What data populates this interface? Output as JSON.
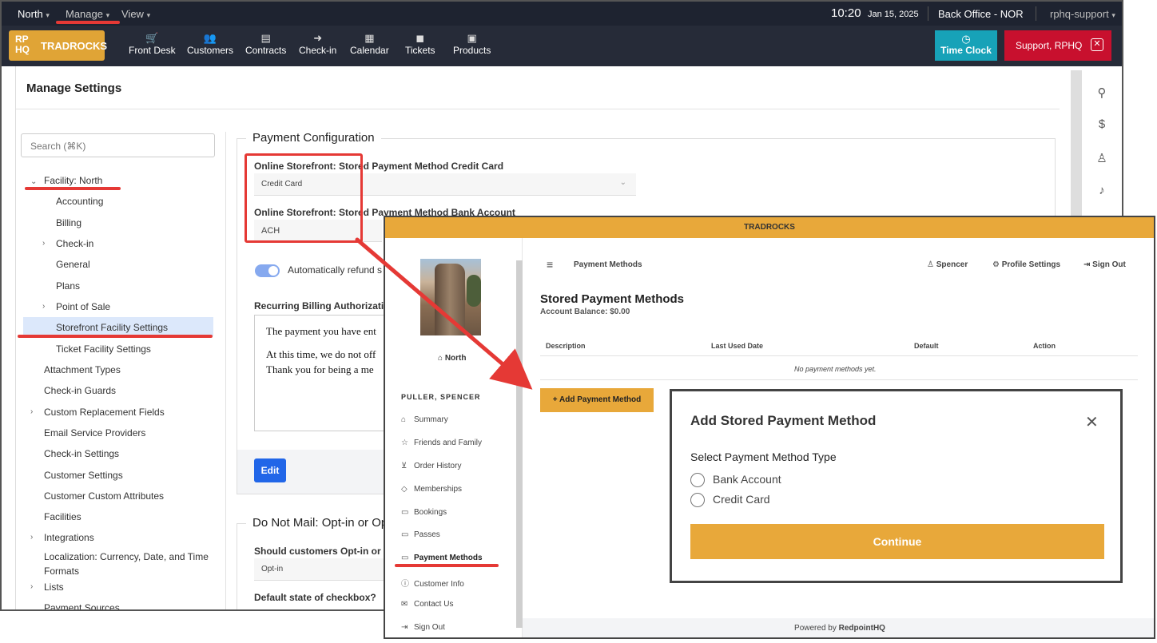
{
  "topbar": {
    "location": "North",
    "menu_manage": "Manage",
    "menu_view": "View",
    "time": "10:20",
    "date": "Jan 15, 2025",
    "office": "Back Office - NOR",
    "user": "rphq-support"
  },
  "navbar": {
    "logo_mark": "RP HQ",
    "logo_name": "TRADROCKS",
    "items": [
      {
        "label": "Front Desk",
        "icon": "cart-icon"
      },
      {
        "label": "Customers",
        "icon": "users-icon"
      },
      {
        "label": "Contracts",
        "icon": "contracts-icon"
      },
      {
        "label": "Check-in",
        "icon": "arrow-circle-icon"
      },
      {
        "label": "Calendar",
        "icon": "calendar-icon"
      },
      {
        "label": "Tickets",
        "icon": "chat-icon"
      },
      {
        "label": "Products",
        "icon": "boxes-icon"
      }
    ],
    "time_clock": "Time Clock",
    "support": "Support, RPHQ"
  },
  "settings": {
    "title": "Manage Settings",
    "search_placeholder": "Search (⌘K)",
    "tree": {
      "facility": "Facility: North",
      "accounting": "Accounting",
      "billing": "Billing",
      "checkin": "Check-in",
      "general": "General",
      "plans": "Plans",
      "pos": "Point of Sale",
      "storefront": "Storefront Facility Settings",
      "ticket": "Ticket Facility Settings",
      "attachment": "Attachment Types",
      "guards": "Check-in Guards",
      "custom_fields": "Custom Replacement Fields",
      "email": "Email Service Providers",
      "checkin_settings": "Check-in Settings",
      "customer_settings": "Customer Settings",
      "custom_attrs": "Customer Custom Attributes",
      "facilities": "Facilities",
      "integrations": "Integrations",
      "localization": "Localization: Currency, Date, and Time Formats",
      "lists": "Lists",
      "payment_sources": "Payment Sources"
    },
    "payment_config": {
      "legend": "Payment Configuration",
      "cc_label": "Online Storefront: Stored Payment Method Credit Card",
      "cc_value": "Credit Card",
      "ach_label": "Online Storefront: Stored Payment Method Bank Account",
      "ach_value": "ACH",
      "toggle_label": "Automatically refund s",
      "recurring_label": "Recurring Billing Authorization",
      "recurring_line1": "The payment you have ent",
      "recurring_line2": "At this time, we do not off",
      "recurring_line3": "Thank you for being a me",
      "edit": "Edit"
    },
    "do_not_mail": {
      "legend": "Do Not Mail: Opt-in or Op",
      "question": "Should customers Opt-in or Op",
      "value": "Opt-in",
      "default_label": "Default state of checkbox?"
    }
  },
  "storefront": {
    "header": "TRADROCKS",
    "location": "North",
    "customer_name": "PULLER, SPENCER",
    "nav": [
      {
        "label": "Summary",
        "icon": "home-icon"
      },
      {
        "label": "Friends and Family",
        "icon": "star-icon"
      },
      {
        "label": "Order History",
        "icon": "cart-icon"
      },
      {
        "label": "Memberships",
        "icon": "tag-icon"
      },
      {
        "label": "Bookings",
        "icon": "calendar-icon"
      },
      {
        "label": "Passes",
        "icon": "ticket-icon"
      },
      {
        "label": "Payment Methods",
        "icon": "card-icon"
      },
      {
        "label": "Customer Info",
        "icon": "info-icon"
      },
      {
        "label": "Contact Us",
        "icon": "mail-icon"
      },
      {
        "label": "Sign Out",
        "icon": "signout-icon"
      }
    ],
    "page_label": "Payment Methods",
    "user": "Spencer",
    "profile": "Profile Settings",
    "signout": "Sign Out",
    "heading": "Stored Payment Methods",
    "balance": "Account Balance: $0.00",
    "columns": [
      "Description",
      "Last Used Date",
      "Default",
      "Action"
    ],
    "empty": "No payment methods yet.",
    "add_button": "+ Add Payment Method",
    "footer_prefix": "Powered by ",
    "footer_brand": "RedpointHQ"
  },
  "modal": {
    "title": "Add Stored Payment Method",
    "subtitle": "Select Payment Method Type",
    "options": [
      "Bank Account",
      "Credit Card"
    ],
    "continue": "Continue"
  },
  "colors": {
    "accent": "#e8a83a",
    "annotation": "#e53935",
    "primary_button": "#2166e8",
    "support": "#c8102e",
    "time_clock": "#17a2b8"
  }
}
